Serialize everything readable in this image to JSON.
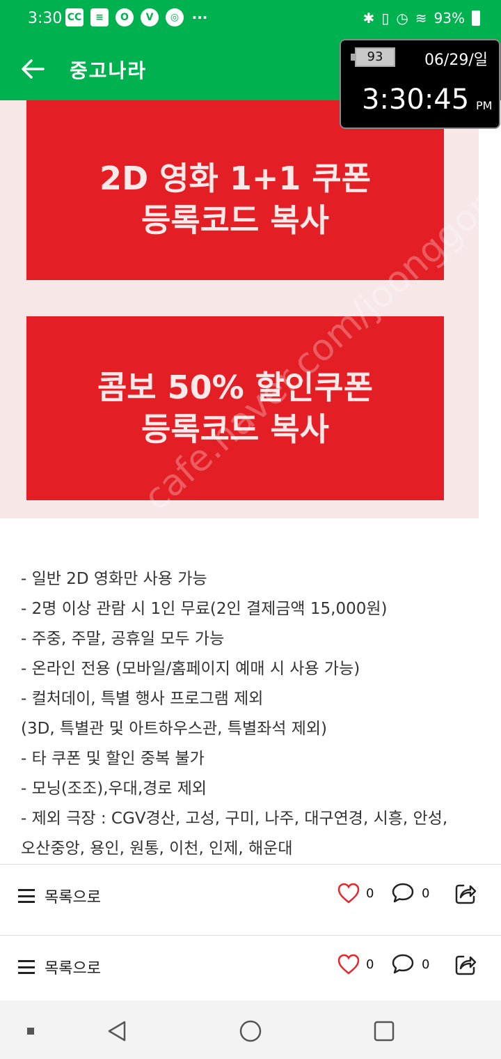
{
  "status_bar": {
    "time": "3:30",
    "battery_percent": "93%",
    "left_icons": [
      "cc-icon",
      "list-icon",
      "o-icon",
      "v-icon",
      "globe-icon",
      "more-dots-icon"
    ]
  },
  "app_bar": {
    "title": "중고나라",
    "back_icon": "arrow-left-icon"
  },
  "clock_widget": {
    "battery": "93",
    "date": "06/29/일",
    "time": "3:30:45",
    "ampm": "PM"
  },
  "post_image": {
    "coupon1_line1": "2D 영화 1+1 쿠폰",
    "coupon1_line2": "등록코드 복사",
    "coupon2_line1": "콤보 50% 할인쿠폰",
    "coupon2_line2": "등록코드 복사",
    "watermark": "cafe.naver.com/joonggonara"
  },
  "post_lines": [
    "- 일반 2D 영화만 사용 가능",
    "- 2명 이상 관람 시 1인 무료(2인 결제금액 15,000원)",
    "- 주중, 주말, 공휴일 모두 가능",
    "- 온라인 전용 (모바일/홈페이지 예매 시 사용 가능)",
    "- 컬처데이, 특별 행사 프로그램 제외",
    "(3D, 특별관 및 아트하우스관, 특별좌석 제외)",
    "- 타 쿠폰 및 할인 중복 불가",
    "- 모닝(조조),우대,경로 제외",
    "- 제외 극장 : CGV경산, 고성, 구미, 나주, 대구연경, 시흥, 안성,",
    "오산중앙, 용인, 원통, 이천, 인제, 해운대"
  ],
  "actions": [
    {
      "list_label": "목록으로",
      "like_count": "0",
      "comment_count": "0"
    },
    {
      "list_label": "목록으로",
      "like_count": "0",
      "comment_count": "0"
    }
  ],
  "colors": {
    "brand_green": "#00b14f",
    "coupon_red": "#e31e24",
    "like_red": "#e5262c"
  }
}
